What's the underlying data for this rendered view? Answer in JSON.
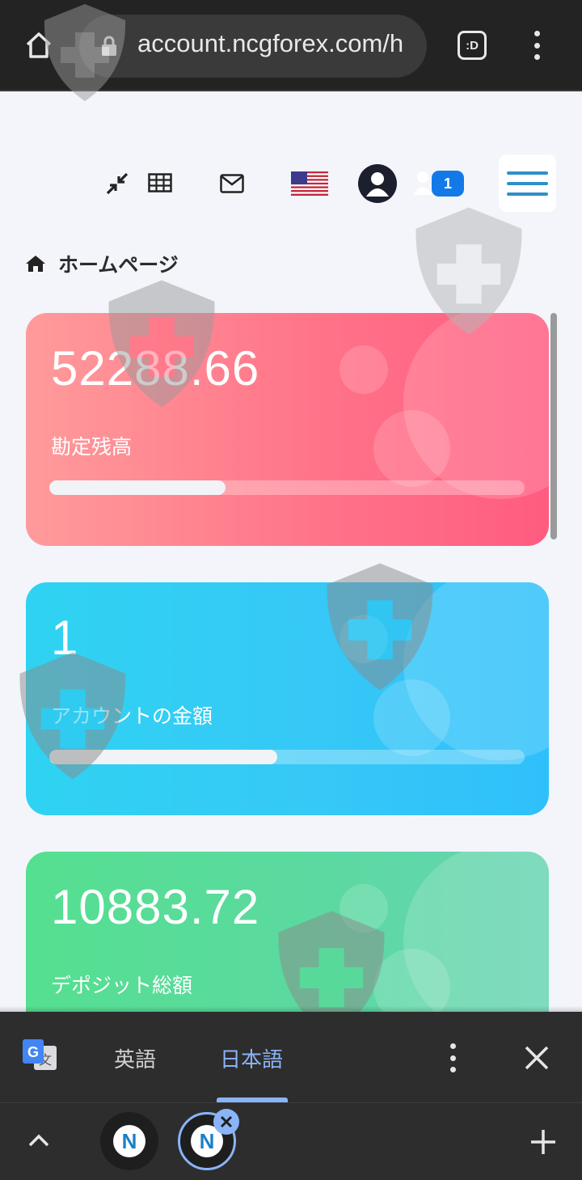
{
  "browser": {
    "url": "account.ncgforex.com/h",
    "tab_switcher_label": ":D"
  },
  "header": {
    "notification_count": "1",
    "flag": "us-flag"
  },
  "breadcrumb": {
    "title": "ホームページ"
  },
  "cards": [
    {
      "value": "52288.66",
      "label": "勘定残高",
      "progress": 0.37,
      "color": "#ff7489"
    },
    {
      "value": "1",
      "label": "アカウントの金額",
      "progress": 0.48,
      "color": "#36c8f6"
    },
    {
      "value": "10883.72",
      "label": "デポジット総額",
      "color": "#5bd9a0"
    }
  ],
  "translate_bar": {
    "source_lang": "英語",
    "target_lang": "日本語",
    "icon": "google-translate-icon"
  },
  "tabs": [
    {
      "favicon": "N"
    },
    {
      "favicon": "N"
    }
  ],
  "colors": {
    "accent_blue": "#1479e8",
    "translate_active": "#8ab4f8"
  }
}
